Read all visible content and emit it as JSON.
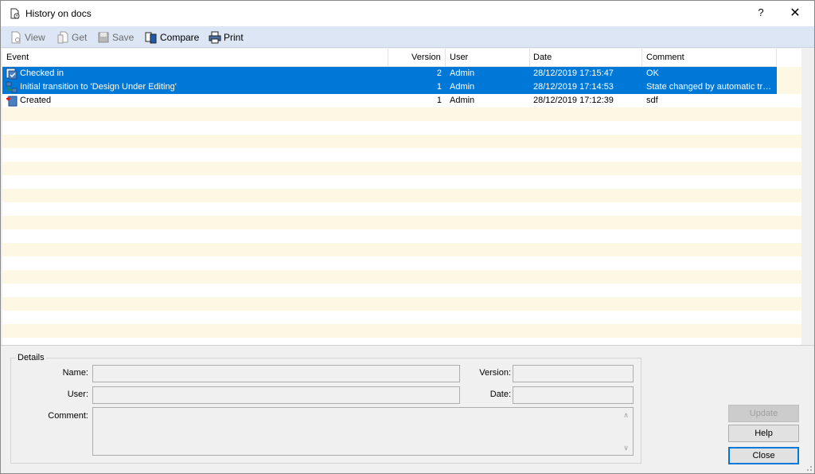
{
  "window": {
    "title": "History on docs",
    "help_glyph": "?",
    "close_glyph": "✕"
  },
  "toolbar": {
    "view_label": "View",
    "get_label": "Get",
    "save_label": "Save",
    "compare_label": "Compare",
    "print_label": "Print"
  },
  "grid": {
    "columns": [
      "Event",
      "Version",
      "User",
      "Date",
      "Comment"
    ],
    "rows": [
      {
        "event": "Checked in",
        "version": "2",
        "user": "Admin",
        "date": "28/12/2019 17:15:47",
        "comment": "OK",
        "selected": true,
        "icon": "checked-in-icon"
      },
      {
        "event": "Initial transition to 'Design Under Editing'",
        "version": "1",
        "user": "Admin",
        "date": "28/12/2019 17:14:53",
        "comment": "State changed by automatic tr…",
        "selected": true,
        "icon": "transition-icon"
      },
      {
        "event": "Created",
        "version": "1",
        "user": "Admin",
        "date": "28/12/2019 17:12:39",
        "comment": "sdf",
        "selected": false,
        "icon": "created-icon"
      }
    ]
  },
  "details": {
    "legend": "Details",
    "name_label": "Name:",
    "version_label": "Version:",
    "user_label": "User:",
    "date_label": "Date:",
    "comment_label": "Comment:",
    "name_value": "",
    "version_value": "",
    "user_value": "",
    "date_value": "",
    "comment_value": ""
  },
  "buttons": {
    "update_label": "Update",
    "help_label": "Help",
    "close_label": "Close"
  },
  "colors": {
    "selection": "#0078d7",
    "alt_row": "#fdf8e3",
    "toolbar_bg": "#dce6f4"
  }
}
